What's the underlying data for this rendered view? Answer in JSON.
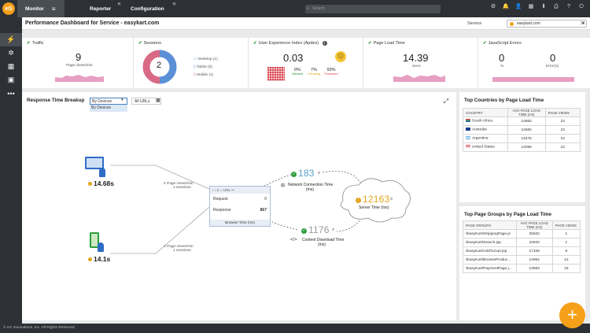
{
  "topbar": {
    "tabs": [
      {
        "label": "Monitor"
      },
      {
        "label": "Reporter"
      },
      {
        "label": "Configuration"
      }
    ],
    "search_placeholder": "Search"
  },
  "header": {
    "title": "Performance Dashboard for Service - easykart.com",
    "service_label": "Service",
    "service_value": "easykart.com"
  },
  "kpis": {
    "traffic": {
      "title": "Traffic",
      "value": "9",
      "unit": "Page views/min"
    },
    "sessions": {
      "title": "Sessions",
      "value": "2",
      "legend": [
        {
          "label": "Desktop",
          "count": "(1)"
        },
        {
          "label": "Tablet",
          "count": "(0)"
        },
        {
          "label": "Mobile",
          "count": "(1)"
        }
      ]
    },
    "apdex": {
      "title": "User Experience Index (Apdex)",
      "value": "0.03",
      "breakdown": [
        {
          "pct": "0%",
          "label": "Satisfied"
        },
        {
          "pct": "7%",
          "label": "Tolerating"
        },
        {
          "pct": "93%",
          "label": "Frustrated"
        }
      ]
    },
    "plt": {
      "title": "Page Load Time",
      "value": "14.39",
      "unit": "Secs"
    },
    "js": {
      "title": "JavaScript Errors",
      "values": [
        {
          "value": "0",
          "unit": "%"
        },
        {
          "value": "0",
          "unit": "Error(s)"
        }
      ]
    }
  },
  "breakup": {
    "title": "Response Time Breakup",
    "dropdown": "By Devices",
    "dropdown_option": "By Devices",
    "url_select": "All URLs",
    "desktop_time": "14.68s",
    "mobile_time": "14.1s",
    "desktop_rate": "4 Page views/min",
    "desktop_sessions": "1 sessions",
    "mobile_rate": "4 Page views/min",
    "mobile_sessions": "1 sessions",
    "browser": {
      "url_label": "URL",
      "request_label": "Request",
      "request_value": "0",
      "response_label": "Response",
      "response_value": "867",
      "footer": "Browser Time (ms)"
    },
    "network": {
      "value": "183",
      "label": "Network Connection Time",
      "unit": "(ms)"
    },
    "server": {
      "value": "12163",
      "label": "Server Time (ms)"
    },
    "download": {
      "value": "1176",
      "label": "Content Download Time",
      "unit": "(ms)"
    }
  },
  "countries": {
    "title": "Top Countries by Page Load Time",
    "headers": [
      "COUNTRY",
      "AVG PAGE LOAD TIME (ms)",
      "PAGE VIEWS"
    ],
    "rows": [
      {
        "name": "South Africa",
        "time": "14682",
        "views": "22"
      },
      {
        "name": "Australia",
        "time": "14682",
        "views": "22"
      },
      {
        "name": "Argentina",
        "time": "14475",
        "views": "22"
      },
      {
        "name": "United States",
        "time": "14095",
        "views": "22"
      }
    ]
  },
  "pagegroups": {
    "title": "Top Page Groups by Page Load Time",
    "headers": [
      "PAGE GROUPS",
      "AVG PAGE LOAD TIME (ms)",
      "PAGE VIEWS"
    ],
    "rows": [
      {
        "name": "/EasyKart/ShippingPage.js",
        "time": "25622",
        "views": "1"
      },
      {
        "name": "/EasyKart/Search.jsp",
        "time": "24942",
        "views": "1"
      },
      {
        "name": "/EasyKart/AddToCart.jsp",
        "time": "17108",
        "views": "8"
      },
      {
        "name": "/EasyKart/BrowseProduc...",
        "time": "14954",
        "views": "12"
      },
      {
        "name": "/EasyKart/PaymentPage.j...",
        "time": "13983",
        "views": "18"
      }
    ]
  },
  "footer": "© eG Innovations, Inc. All Rights Reserved",
  "colors": {
    "accent": "#f6a01a",
    "desktop": "#5b8fd6",
    "mobile": "#d96a86",
    "frustrated": "#d9434f"
  }
}
